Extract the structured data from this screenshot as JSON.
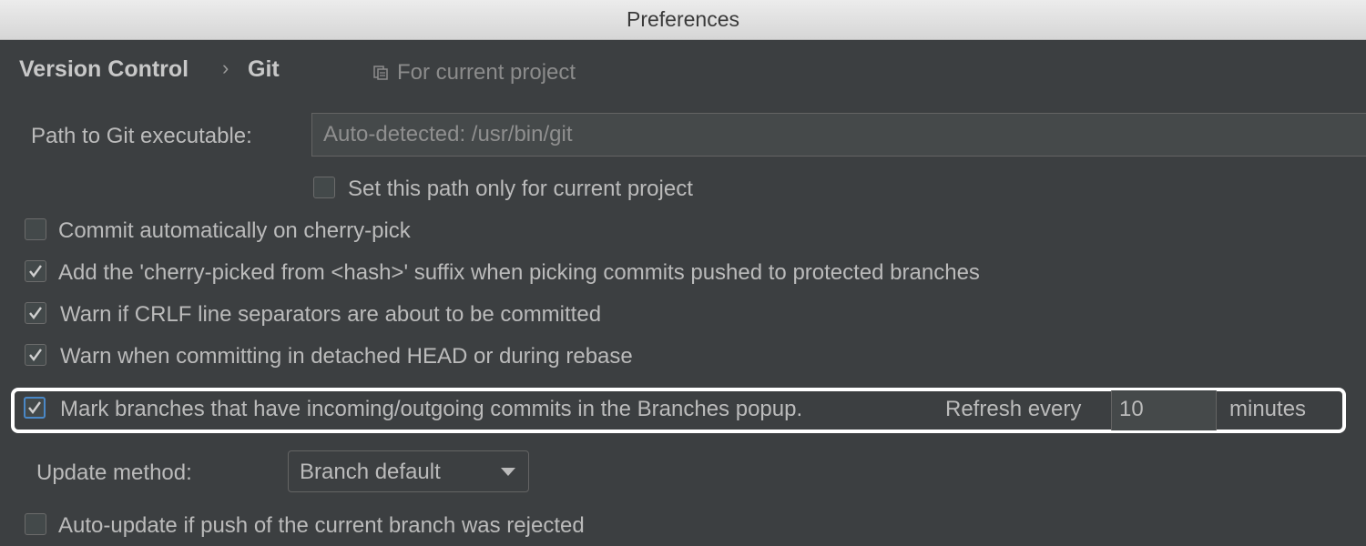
{
  "window": {
    "title": "Preferences"
  },
  "breadcrumb": {
    "parent": "Version Control",
    "separator": "›",
    "current": "Git"
  },
  "scope": {
    "text": "For current project",
    "icon": "project-scope-icon"
  },
  "git_path": {
    "label": "Path to Git executable:",
    "value": "Auto-detected: /usr/bin/git",
    "set_for_project_label": "Set this path only for current project",
    "set_for_project_checked": false
  },
  "options": [
    {
      "label": "Commit automatically on cherry-pick",
      "checked": false
    },
    {
      "label": "Add the 'cherry-picked from <hash>' suffix when picking commits pushed to protected branches",
      "checked": true
    },
    {
      "label": "Warn if CRLF line separators are about to be committed",
      "checked": true
    },
    {
      "label": "Warn when committing in detached HEAD or during rebase",
      "checked": true
    }
  ],
  "mark_branches": {
    "label": "Mark branches that have incoming/outgoing commits in the Branches popup.",
    "refresh_label": "Refresh every",
    "refresh_value": "10",
    "units": "minutes",
    "checked": true
  },
  "update_method": {
    "label": "Update method:",
    "selected": "Branch default"
  },
  "auto_update": {
    "label": "Auto-update if push of the current branch was rejected",
    "checked": false
  },
  "colors": {
    "background": "#3c3f41",
    "accent": "#4a88c7",
    "highlight": "#ffffff"
  }
}
